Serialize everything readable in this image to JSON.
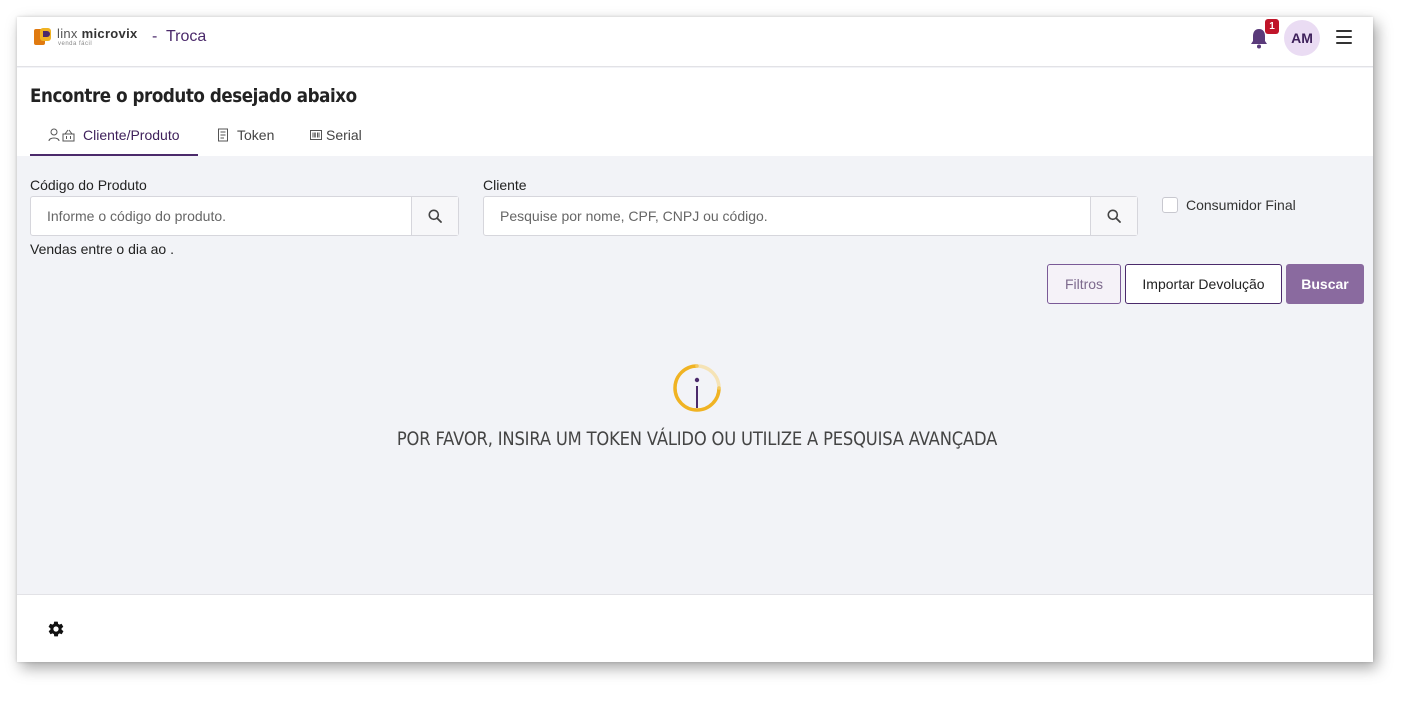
{
  "header": {
    "brand_light": "linx",
    "brand_bold": "microvix",
    "brand_sub": "venda fácil",
    "separator": "-",
    "page_name": "Troca",
    "notification_count": "1",
    "user_initials": "AM",
    "icons": [
      "logo-icon",
      "bell-icon",
      "menu-icon"
    ]
  },
  "main": {
    "title": "Encontre o produto desejado abaixo",
    "tabs": [
      {
        "label": "Cliente/Produto",
        "icon": "user-basket-icon",
        "active": true
      },
      {
        "label": "Token",
        "icon": "receipt-icon",
        "active": false
      },
      {
        "label": "Serial",
        "icon": "barcode-icon",
        "active": false
      }
    ],
    "form": {
      "product_code_label": "Código do Produto",
      "product_code_placeholder": "Informe o código do produto.",
      "product_code_value": "",
      "client_label": "Cliente",
      "client_placeholder": "Pesquise por nome, CPF, CNPJ ou código.",
      "client_value": "",
      "final_consumer_label": "Consumidor Final",
      "final_consumer_checked": false,
      "sales_period_text": "Vendas entre o dia  ao ."
    },
    "buttons": {
      "filters": "Filtros",
      "import_return": "Importar Devolução",
      "search": "Buscar"
    },
    "empty_state": {
      "icon": "info-icon",
      "message": "POR FAVOR, INSIRA UM TOKEN VÁLIDO OU UTILIZE A PESQUISA AVANÇADA"
    }
  },
  "footer": {
    "icons": [
      "gear-icon"
    ]
  },
  "colors": {
    "primary": "#4b2a6b",
    "button_primary": "#8a6a9f",
    "badge": "#c0152a",
    "avatar_bg": "#eadcf3",
    "info_accent": "#f0b323",
    "background": "#f2f3f7"
  }
}
